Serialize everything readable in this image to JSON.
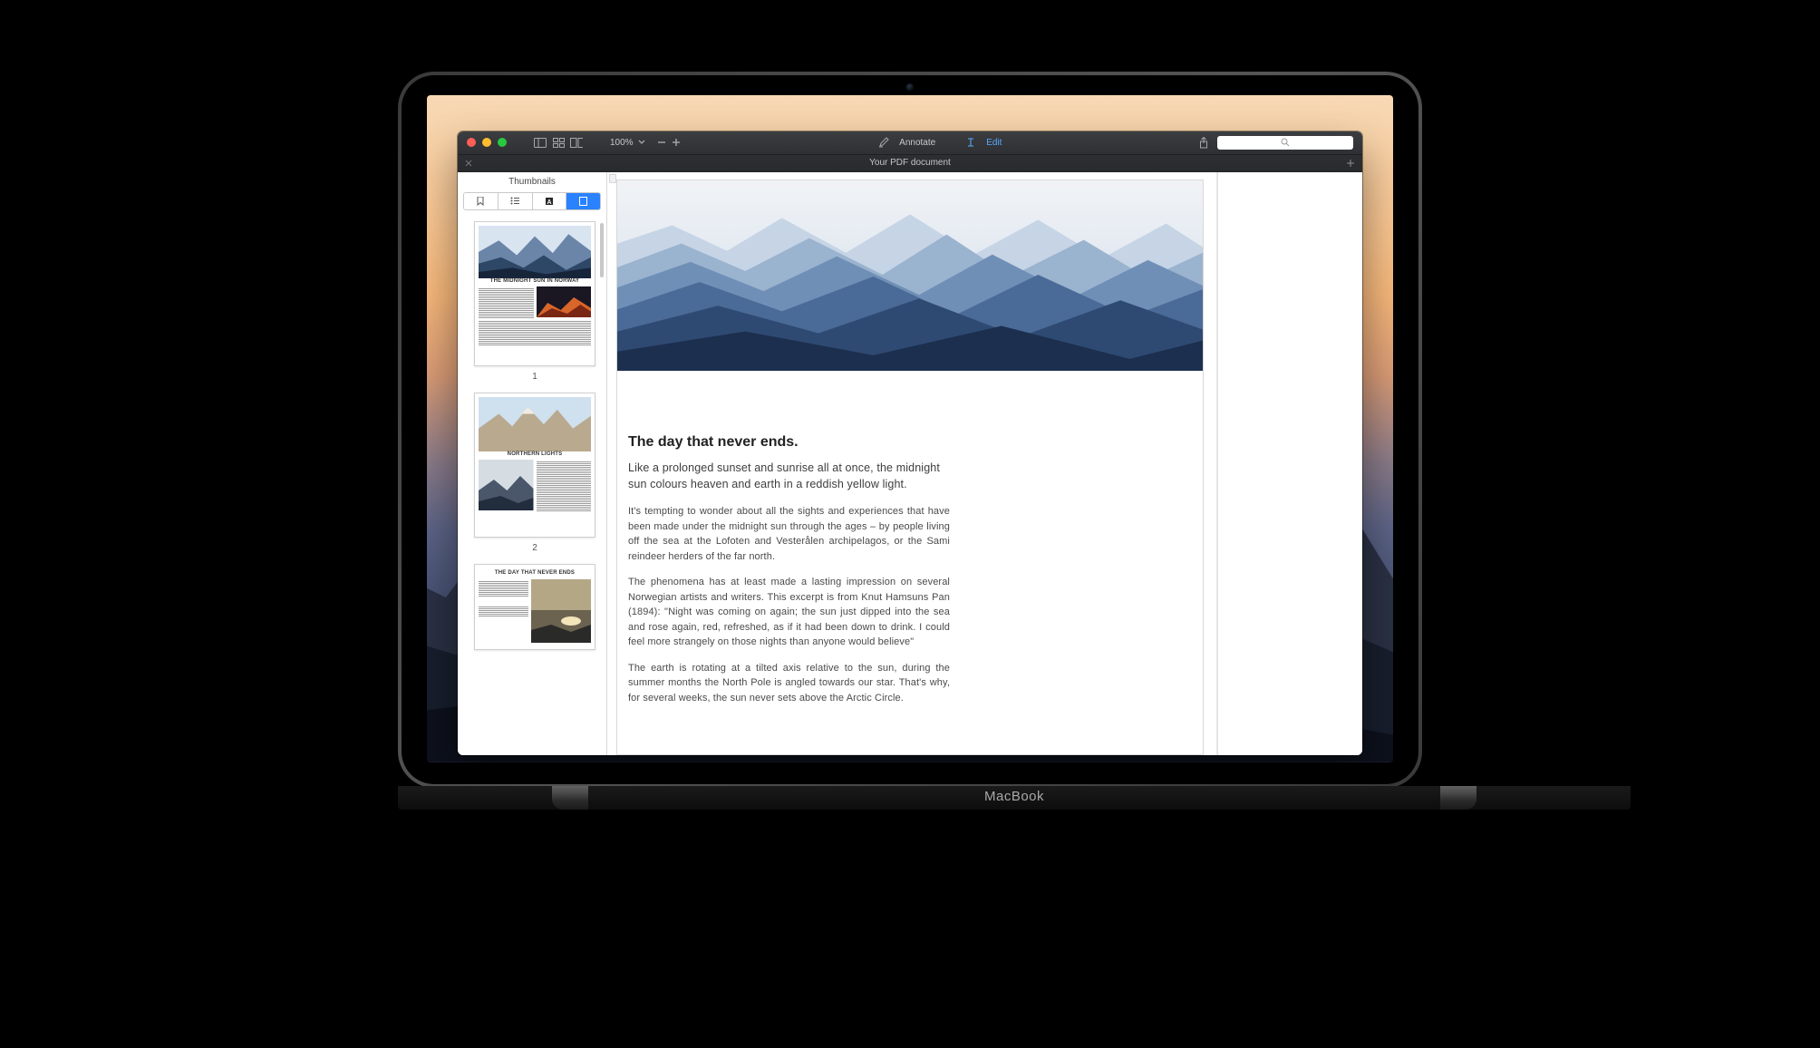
{
  "toolbar": {
    "zoom_level": "100%",
    "annotate_label": "Annotate",
    "edit_label": "Edit"
  },
  "tab": {
    "title": "Your PDF document"
  },
  "sidebar": {
    "title": "Thumbnails",
    "thumbs": [
      {
        "title": "THE MIDNIGHT SUN IN NORWAY",
        "num": "1"
      },
      {
        "title": "NORTHERN LIGHTS",
        "num": "2"
      },
      {
        "title": "THE DAY THAT NEVER ENDS",
        "num": ""
      }
    ]
  },
  "document": {
    "heading": "The day that never ends.",
    "lead": "Like a prolonged sunset and sunrise all at once, the midnight sun colours heaven and earth in a reddish yellow light.",
    "p1": "It's tempting to wonder about all the sights and experiences that have been made under the midnight sun through the ages – by people living off the sea at the Lofoten and Vesterålen archipelagos, or the Sami reindeer herders of the far north.",
    "p2": "The phenomena has at least made a lasting impression on several Norwegian artists and writers. This excerpt is from Knut Hamsuns Pan (1894): \"Night was coming on again; the sun just dipped into the sea and rose again, red, refreshed, as if it had been down to drink. I could feel more strangely on those nights than anyone would believe\"",
    "p3": "The earth is rotating at a tilted axis relative to the sun, during the summer months the North Pole is angled towards our star. That's why, for several weeks, the sun never sets above the Arctic Circle."
  },
  "hardware": {
    "label": "MacBook"
  }
}
